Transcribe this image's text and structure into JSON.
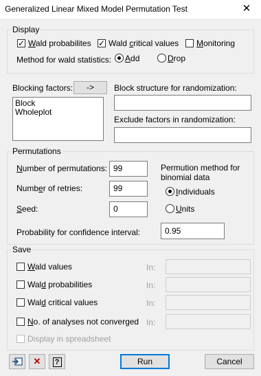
{
  "window": {
    "title": "Generalized Linear Mixed Model Permutation Test",
    "close_glyph": "✕"
  },
  "display": {
    "legend": "Display",
    "wald_probabilities": {
      "pre": "",
      "u": "W",
      "post": "ald probabilites",
      "checked": true
    },
    "wald_critical_values": {
      "pre": "Wald ",
      "u": "c",
      "post": "ritical values",
      "checked": true
    },
    "monitoring": {
      "pre": "",
      "u": "M",
      "post": "onitoring",
      "checked": false
    },
    "method_label": "Method for wald statistics:",
    "add": {
      "pre": "",
      "u": "A",
      "post": "dd",
      "selected": true
    },
    "drop": {
      "pre": "",
      "u": "D",
      "post": "rop",
      "selected": false
    }
  },
  "blocking": {
    "label": "Blocking factors:",
    "arrow_button": "->",
    "items": [
      "Block",
      "Wholeplot"
    ],
    "block_structure_label": "Block structure for randomization:",
    "block_structure_value": "",
    "exclude_label": "Exclude factors in randomization:",
    "exclude_value": ""
  },
  "permutations": {
    "legend": "Permutations",
    "num_perm": {
      "pre": "",
      "u": "N",
      "post": "umber of permutations:",
      "value": "99"
    },
    "num_retries": {
      "pre": "Numb",
      "u": "e",
      "post": "r of retries:",
      "value": "99"
    },
    "seed": {
      "pre": "",
      "u": "S",
      "post": "eed:",
      "value": "0"
    },
    "method_title": "Permution method for binomial data",
    "individuals": {
      "pre": "",
      "u": "I",
      "post": "ndividuals",
      "selected": true
    },
    "units": {
      "pre": "",
      "u": "U",
      "post": "nits",
      "selected": false
    },
    "prob_label": "Probability for confidence interval:",
    "prob_value": "0.95"
  },
  "save": {
    "legend": "Save",
    "in_label": "In:",
    "items": [
      {
        "pre": "",
        "u": "W",
        "post": "ald values"
      },
      {
        "pre": "Wal",
        "u": "d",
        "post": " probabilities"
      },
      {
        "pre": "Wal",
        "u": "d",
        "post": " critical values"
      },
      {
        "pre": "",
        "u": "N",
        "post": "o. of analyses not  converged"
      }
    ],
    "spreadsheet": "Display in spreadsheet"
  },
  "footer": {
    "run": "Run",
    "cancel": "Cancel",
    "help_glyph": "?",
    "delete_glyph": "✕"
  }
}
